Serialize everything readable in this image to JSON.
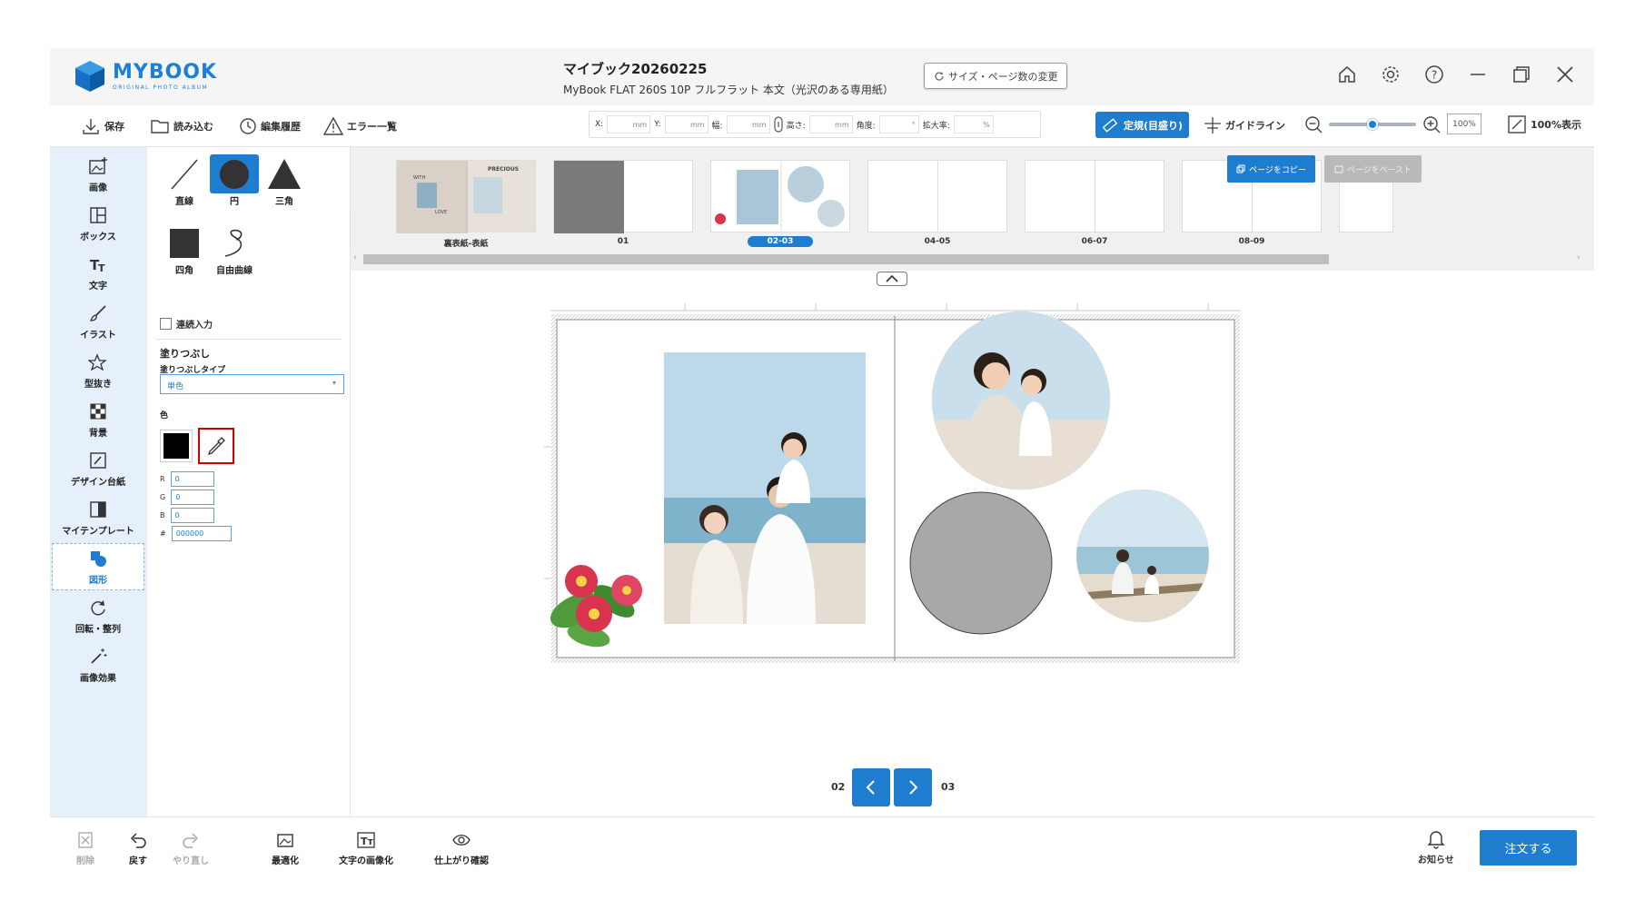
{
  "app": {
    "logo_text": "MYBOOK",
    "logo_sub": "ORIGINAL PHOTO ALBUM"
  },
  "title": {
    "name": "マイブック20260225",
    "product": "MyBook FLAT 260S 10P フルフラット 本文（光沢のある専用紙）",
    "size_button": "サイズ・ページ数の変更"
  },
  "toolbar": {
    "save": "保存",
    "load": "読み込む",
    "history": "編集履歴",
    "errors": "エラー一覧",
    "x_label": "X:",
    "y_label": "Y:",
    "w_label": "幅:",
    "h_label": "高さ:",
    "angle_label": "角度:",
    "scale_label": "拡大率:",
    "unit_mm": "mm",
    "unit_deg": "°",
    "unit_pct": "%",
    "ruler": "定規(目盛り)",
    "guide": "ガイドライン",
    "zoom_value": "100%",
    "zoom_level": 0.5,
    "full_view": "100%表示"
  },
  "leftnav": {
    "items": [
      {
        "label": "画像",
        "icon": "image-add-icon"
      },
      {
        "label": "ボックス",
        "icon": "layout-box-icon"
      },
      {
        "label": "文字",
        "icon": "text-icon"
      },
      {
        "label": "イラスト",
        "icon": "brush-icon"
      },
      {
        "label": "型抜き",
        "icon": "star-cutout-icon"
      },
      {
        "label": "背景",
        "icon": "checker-background-icon"
      },
      {
        "label": "デザイン台紙",
        "icon": "design-sheet-icon"
      },
      {
        "label": "マイテンプレート",
        "icon": "template-icon"
      },
      {
        "label": "図形",
        "icon": "shapes-icon"
      },
      {
        "label": "回転・整列",
        "icon": "rotate-icon"
      },
      {
        "label": "画像効果",
        "icon": "magic-wand-icon"
      }
    ],
    "active": "図形"
  },
  "panel": {
    "shapes": [
      {
        "label": "直線"
      },
      {
        "label": "円"
      },
      {
        "label": "三角"
      },
      {
        "label": "四角"
      },
      {
        "label": "自由曲線"
      }
    ],
    "selected_shape": "円",
    "continuous": "連続入力",
    "fill_heading": "塗りつぶし",
    "fill_type_label": "塗りつぶしタイプ",
    "fill_type_value": "単色",
    "color_label": "色",
    "color_hex_swatch": "#000000",
    "r_label": "R",
    "r_value": "0",
    "g_label": "G",
    "g_value": "0",
    "b_label": "B",
    "b_value": "0",
    "hex_label": "#",
    "hex_value": "000000"
  },
  "thumbs": {
    "copy": "ページをコピー",
    "paste": "ページをペースト",
    "items": [
      {
        "label": "裏表紙-表紙"
      },
      {
        "label": "01"
      },
      {
        "label": "02-03"
      },
      {
        "label": "04-05"
      },
      {
        "label": "06-07"
      },
      {
        "label": "08-09"
      }
    ],
    "selected": "02-03",
    "cover_text_1": "PRECIOUS",
    "cover_text_2": "WITH",
    "cover_text_3": "LOVE"
  },
  "pager": {
    "prev_page": "02",
    "next_page": "03"
  },
  "bottom": {
    "delete": "削除",
    "undo": "戻す",
    "redo": "やり直し",
    "optimize": "最適化",
    "text_to_image": "文字の画像化",
    "preview": "仕上がり確認",
    "notice": "お知らせ",
    "order": "注文する"
  },
  "colors": {
    "accent": "#1e7dcf",
    "nav_bg": "#e6f0fa",
    "shape_fill": "#a8a8a8"
  }
}
